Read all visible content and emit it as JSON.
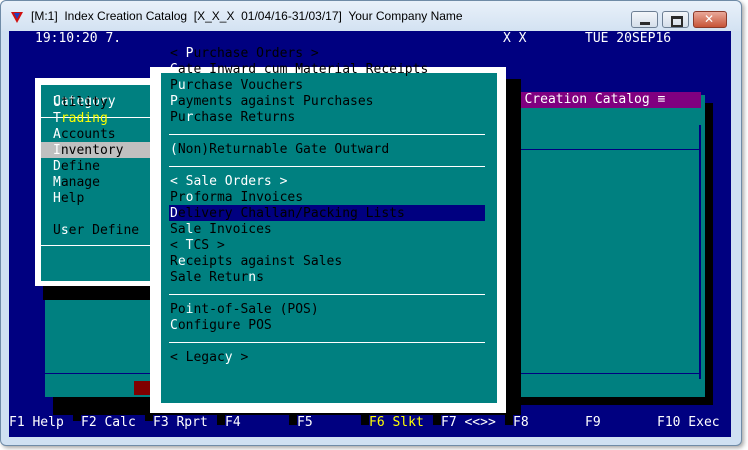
{
  "window": {
    "title": "[M:1]  Index Creation Catalog  [X_X_X  01/04/16-31/03/17]  Your Company Name"
  },
  "header": {
    "time": "19:10:20 7.",
    "company_code": "X X",
    "date": "TUE 20SEP16"
  },
  "background_window": {
    "title": "ex Creation Catalog ≡"
  },
  "category_menu": {
    "title": "Category",
    "items": [
      {
        "pre": "",
        "hot": "U",
        "post": "tility"
      },
      {
        "pre": "",
        "hot": "T",
        "post": "rading"
      },
      {
        "pre": "",
        "hot": "A",
        "post": "ccounts"
      },
      {
        "pre": "",
        "hot": "I",
        "post": "nventory"
      },
      {
        "pre": "",
        "hot": "D",
        "post": "efine"
      },
      {
        "pre": "",
        "hot": "M",
        "post": "anage"
      },
      {
        "pre": "",
        "hot": "H",
        "post": "elp"
      },
      {
        "pre": "U",
        "hot": "s",
        "post": "er Define"
      }
    ],
    "selected_index": 1
  },
  "trading_menu": {
    "items": [
      {
        "pre": "< ",
        "hot": "P",
        "post": "urchase Orders >"
      },
      {
        "pre": "",
        "hot": "G",
        "post": "ate Inward cum Material Receipts"
      },
      {
        "pre": "P",
        "hot": "u",
        "post": "rchase Vouchers"
      },
      {
        "pre": "",
        "hot": "P",
        "post": "ayments against Purchases"
      },
      {
        "pre": "Pu",
        "hot": "r",
        "post": "chase Returns"
      },
      {
        "pre": "",
        "hot": "(",
        "post": "Non)Returnable Gate Outward"
      },
      {
        "pre": "< ",
        "hot": "S",
        "post": "ale Orders >"
      },
      {
        "pre": "Pr",
        "hot": "o",
        "post": "forma Invoices"
      },
      {
        "pre": "",
        "hot": "D",
        "post": "elivery Challan/Packing Lists"
      },
      {
        "pre": "Sa",
        "hot": "l",
        "post": "e Invoices"
      },
      {
        "pre": "< ",
        "hot": "T",
        "post": "CS >"
      },
      {
        "pre": "R",
        "hot": "e",
        "post": "ceipts against Sales"
      },
      {
        "pre": "Sale Retur",
        "hot": "n",
        "post": "s"
      },
      {
        "pre": "Po",
        "hot": "i",
        "post": "nt-of-Sale (POS)"
      },
      {
        "pre": "",
        "hot": "C",
        "post": "onfigure POS"
      },
      {
        "pre": "< Legac",
        "hot": "y",
        "post": " >"
      }
    ],
    "selected_index": 6
  },
  "function_keys": [
    "F1 Help",
    "F2 Calc",
    "F3 Rprt",
    "F4",
    "F5",
    "F6 Slkt",
    "F7 <<>>",
    "F8",
    "F9",
    "F10 Exec"
  ],
  "colors": {
    "teal": "#008080",
    "navy": "#000080",
    "highlight_yellow": "#ffff00"
  }
}
